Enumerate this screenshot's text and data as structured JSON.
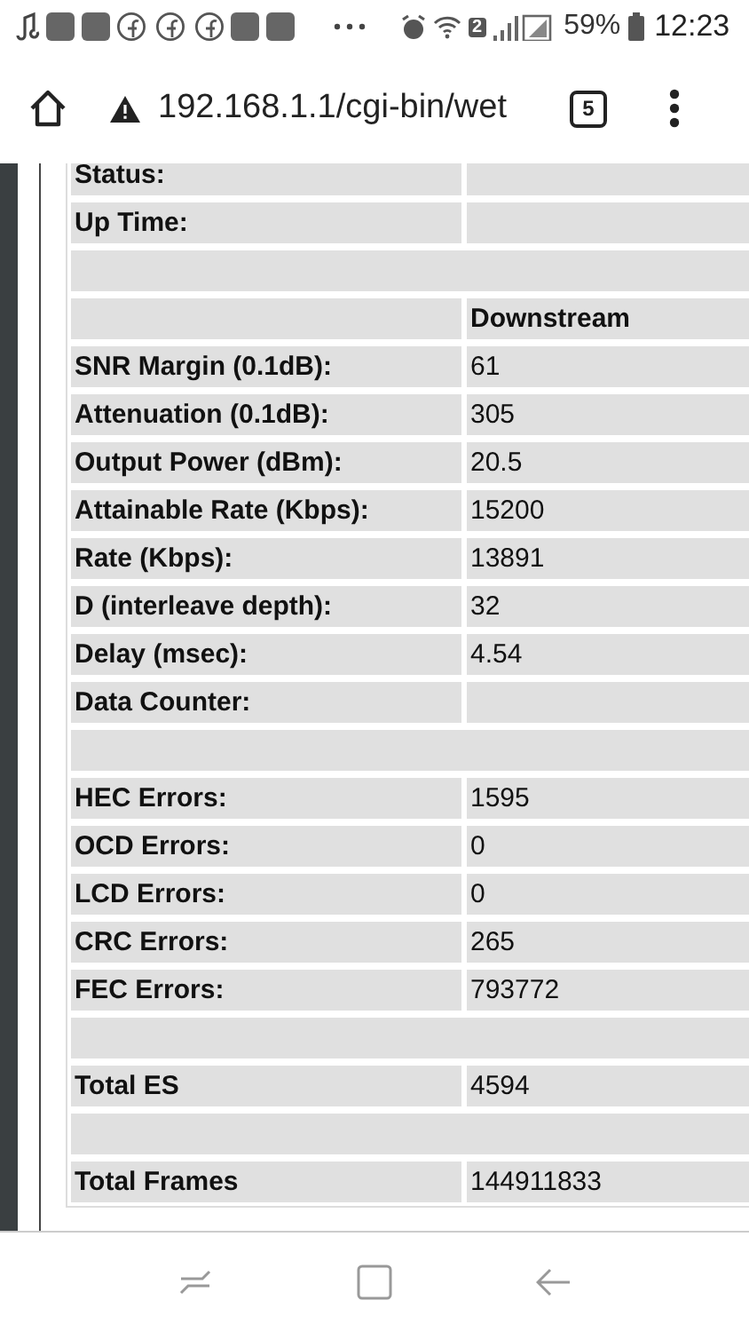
{
  "status_bar": {
    "wifi_badge": "2",
    "battery": "59%",
    "time": "12:23"
  },
  "address_bar": {
    "url": "192.168.1.1/cgi-bin/wet",
    "tab_count": "5"
  },
  "table": {
    "rows": [
      {
        "kind": "pair",
        "label": "Status:"
      },
      {
        "kind": "pair",
        "label": "Up Time:"
      },
      {
        "kind": "blank"
      },
      {
        "kind": "header",
        "value": "Downstream"
      },
      {
        "kind": "pair",
        "label": "SNR Margin (0.1dB):",
        "value": "61"
      },
      {
        "kind": "pair",
        "label": "Attenuation (0.1dB):",
        "value": "305"
      },
      {
        "kind": "pair",
        "label": "Output Power (dBm):",
        "value": "20.5"
      },
      {
        "kind": "pair",
        "label": "Attainable Rate (Kbps):",
        "value": "15200"
      },
      {
        "kind": "pair",
        "label": "Rate (Kbps):",
        "value": "13891"
      },
      {
        "kind": "pair",
        "label": "D (interleave depth):",
        "value": "32"
      },
      {
        "kind": "pair",
        "label": "Delay (msec):",
        "value": "4.54"
      },
      {
        "kind": "pair",
        "label": "Data Counter:"
      },
      {
        "kind": "blank"
      },
      {
        "kind": "pair",
        "label": "HEC Errors:",
        "value": "1595"
      },
      {
        "kind": "pair",
        "label": "OCD Errors:",
        "value": "0"
      },
      {
        "kind": "pair",
        "label": "LCD Errors:",
        "value": "0"
      },
      {
        "kind": "pair",
        "label": "CRC Errors:",
        "value": "265"
      },
      {
        "kind": "pair",
        "label": "FEC Errors:",
        "value": "793772"
      },
      {
        "kind": "blank"
      },
      {
        "kind": "pair",
        "label": "Total ES",
        "value": "4594"
      },
      {
        "kind": "blank"
      },
      {
        "kind": "pair",
        "label": "Total Frames",
        "value": "144911833"
      }
    ]
  }
}
